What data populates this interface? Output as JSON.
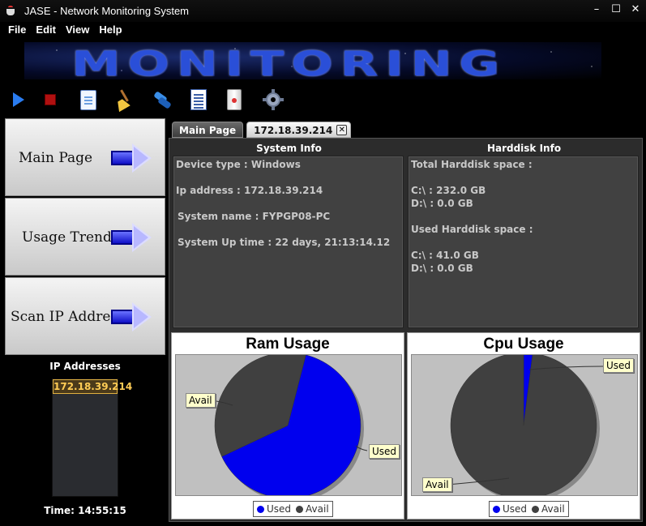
{
  "window": {
    "title": "JASE - Network Monitoring System",
    "controls": [
      "–",
      "☐",
      "✕"
    ]
  },
  "menu": [
    "File",
    "Edit",
    "View",
    "Help"
  ],
  "banner": {
    "text": "MONITORING"
  },
  "toolbar": {
    "icons": [
      "play-icon",
      "stop-icon",
      "document-icon",
      "broom-icon",
      "refresh-icon",
      "list-icon",
      "disk-icon",
      "gear-icon"
    ]
  },
  "nav": [
    {
      "label": "Main Page"
    },
    {
      "label": "Usage Trend"
    },
    {
      "label": "Scan IP Address"
    }
  ],
  "ip_panel": {
    "heading": "IP Addresses",
    "items": [
      "172.18.39.214"
    ]
  },
  "time": "Time: 14:55:15",
  "tabs": [
    {
      "label": "Main Page",
      "active": false
    },
    {
      "label": "172.18.39.214",
      "active": true
    }
  ],
  "system_info": {
    "heading": "System Info",
    "lines": [
      "Device type : Windows",
      "Ip address : 172.18.39.214",
      "System name : FYPGP08-PC",
      "System Up time : 22 days, 21:13:14.12"
    ]
  },
  "harddisk_info": {
    "heading": "Harddisk Info",
    "total_label": "Total Harddisk space :",
    "total": [
      "C:\\ : 232.0 GB",
      "D:\\ : 0.0 GB"
    ],
    "used_label": "Used Harddisk space :",
    "used": [
      "C:\\ : 41.0 GB",
      "D:\\ : 0.0 GB"
    ]
  },
  "colors": {
    "used": "#0000ee",
    "avail": "#404040"
  },
  "charts": {
    "ram": {
      "title": "Ram Usage",
      "labels": {
        "used": "Used",
        "avail": "Avail"
      },
      "legend": [
        "Used",
        "Avail"
      ]
    },
    "cpu": {
      "title": "Cpu Usage",
      "labels": {
        "used": "Used",
        "avail": "Avail"
      },
      "legend": [
        "Used",
        "Avail"
      ]
    }
  },
  "chart_data": [
    {
      "type": "pie",
      "title": "Ram Usage",
      "categories": [
        "Used",
        "Avail"
      ],
      "values": [
        64,
        36
      ]
    },
    {
      "type": "pie",
      "title": "Cpu Usage",
      "categories": [
        "Used",
        "Avail"
      ],
      "values": [
        2,
        98
      ]
    }
  ]
}
